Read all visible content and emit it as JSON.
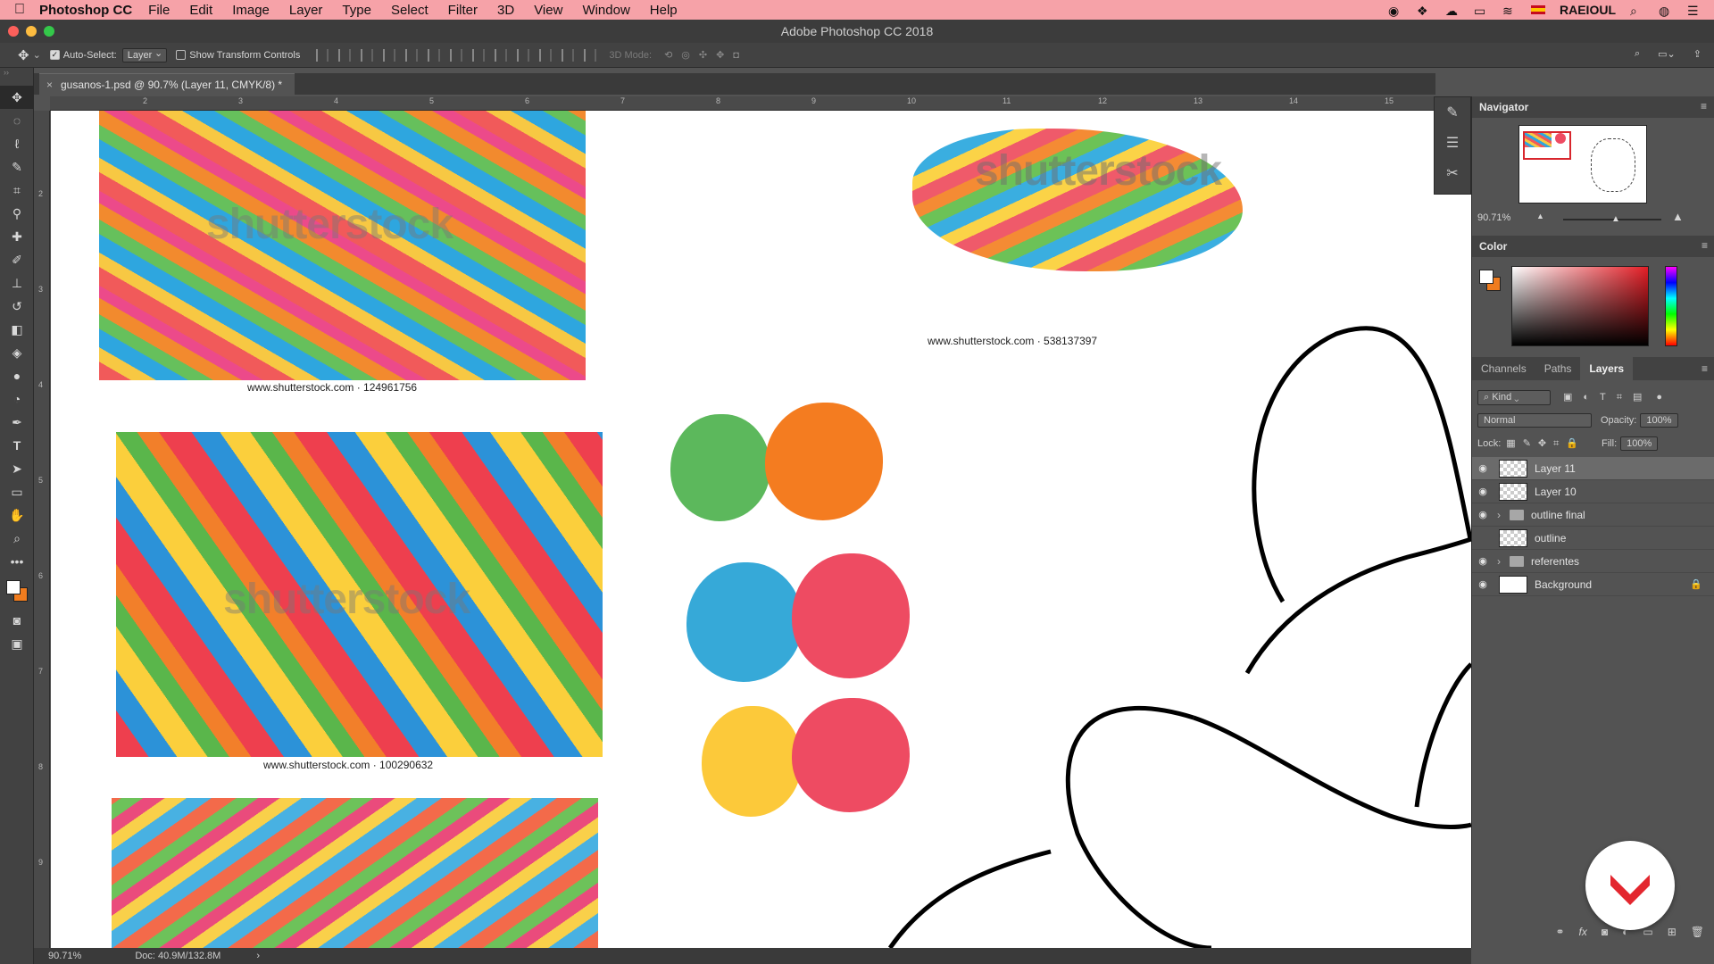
{
  "menubar": {
    "app_name": "Photoshop CC",
    "items": [
      "File",
      "Edit",
      "Image",
      "Layer",
      "Type",
      "Select",
      "Filter",
      "3D",
      "View",
      "Window",
      "Help"
    ],
    "user": "RAEIOUL"
  },
  "window": {
    "title": "Adobe Photoshop CC 2018"
  },
  "options_bar": {
    "auto_select_label": "Auto-Select:",
    "auto_select_value": "Layer",
    "transform_controls_label": "Show Transform Controls",
    "mode_3d_label": "3D Mode:"
  },
  "document": {
    "tab_title": "gusanos-1.psd @ 90.7% (Layer 11, CMYK/8) *"
  },
  "rulers": {
    "h_ticks": [
      "2",
      "3",
      "4",
      "5",
      "6",
      "7",
      "8",
      "9",
      "10",
      "11",
      "12",
      "13",
      "14",
      "15"
    ],
    "v_ticks": [
      "2",
      "3",
      "4",
      "5",
      "6",
      "7",
      "8",
      "9"
    ]
  },
  "canvas": {
    "watermark": "shutterstock",
    "credits": [
      "www.shutterstock.com · 124961756",
      "www.shutterstock.com · 538137397",
      "www.shutterstock.com · 100290632"
    ],
    "palette": [
      "#5cb85c",
      "#f47c20",
      "#36a9d8",
      "#ee4b62",
      "#fcc93a",
      "#ee4b62"
    ]
  },
  "status": {
    "zoom": "90.71%",
    "doc_size": "Doc: 40.9M/132.8M"
  },
  "navigator": {
    "title": "Navigator",
    "zoom": "90.71%"
  },
  "color_panel": {
    "title": "Color",
    "foreground": "#ffffff",
    "background": "#f07c1e"
  },
  "layers_panel": {
    "tabs": [
      "Channels",
      "Paths",
      "Layers"
    ],
    "active_tab": "Layers",
    "filter_label": "Kind",
    "blend_mode": "Normal",
    "opacity_label": "Opacity:",
    "opacity_value": "100%",
    "lock_label": "Lock:",
    "fill_label": "Fill:",
    "fill_value": "100%",
    "layers": [
      {
        "name": "Layer 11",
        "visible": true,
        "selected": true
      },
      {
        "name": "Layer 10",
        "visible": true
      },
      {
        "name": "outline final",
        "visible": true,
        "group": true
      },
      {
        "name": "outline",
        "visible": false
      },
      {
        "name": "referentes",
        "visible": true,
        "group": true
      },
      {
        "name": "Background",
        "visible": true,
        "locked": true
      }
    ]
  }
}
